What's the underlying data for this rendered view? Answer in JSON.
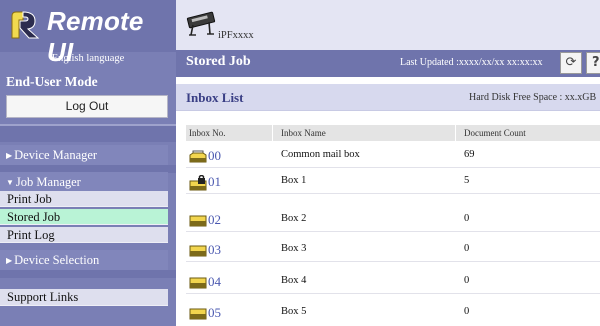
{
  "brand": {
    "title": "Remote UI",
    "icon": "remote-ui-logo-icon"
  },
  "sidebar": {
    "language": "English language",
    "mode_title": "End-User Mode",
    "logout_label": "Log Out",
    "device_manager": "Device Manager",
    "job_manager": "Job Manager",
    "job_items": [
      "Print Job",
      "Stored Job",
      "Print Log"
    ],
    "active_item": "Stored Job",
    "device_selection": "Device Selection",
    "support_links": "Support Links"
  },
  "header": {
    "printer_name": "iPFxxxx",
    "printer_icon": "printer-icon",
    "page_title": "Stored Job",
    "last_updated": "Last Updated :xxxx/xx/xx xx:xx:xx",
    "refresh_icon": "refresh-icon",
    "help_label": "?"
  },
  "inbox": {
    "section_title": "Inbox List",
    "disk_free": "Hard Disk Free Space : xx.xGB",
    "columns": [
      "Inbox No.",
      "Inbox Name",
      "Document Count"
    ],
    "rows": [
      {
        "no": "00",
        "name": "Common mail box",
        "count": "69",
        "icon": "inbox-tray-icon"
      },
      {
        "no": "01",
        "name": "Box 1",
        "count": "5",
        "icon": "locked-inbox-icon"
      },
      {
        "no": "02",
        "name": "Box 2",
        "count": "0",
        "icon": "inbox-icon"
      },
      {
        "no": "03",
        "name": "Box 3",
        "count": "0",
        "icon": "inbox-icon"
      },
      {
        "no": "04",
        "name": "Box 4",
        "count": "0",
        "icon": "inbox-icon"
      },
      {
        "no": "05",
        "name": "Box 5",
        "count": "0",
        "icon": "inbox-icon"
      }
    ]
  },
  "colors": {
    "sidebar": "#7a7fb5",
    "title_bar": "#6f74ac",
    "active_item": "#b9f3d6",
    "link": "#4a58b0",
    "header_band": "#e4e5f3",
    "section_band": "#d7d9ee"
  }
}
